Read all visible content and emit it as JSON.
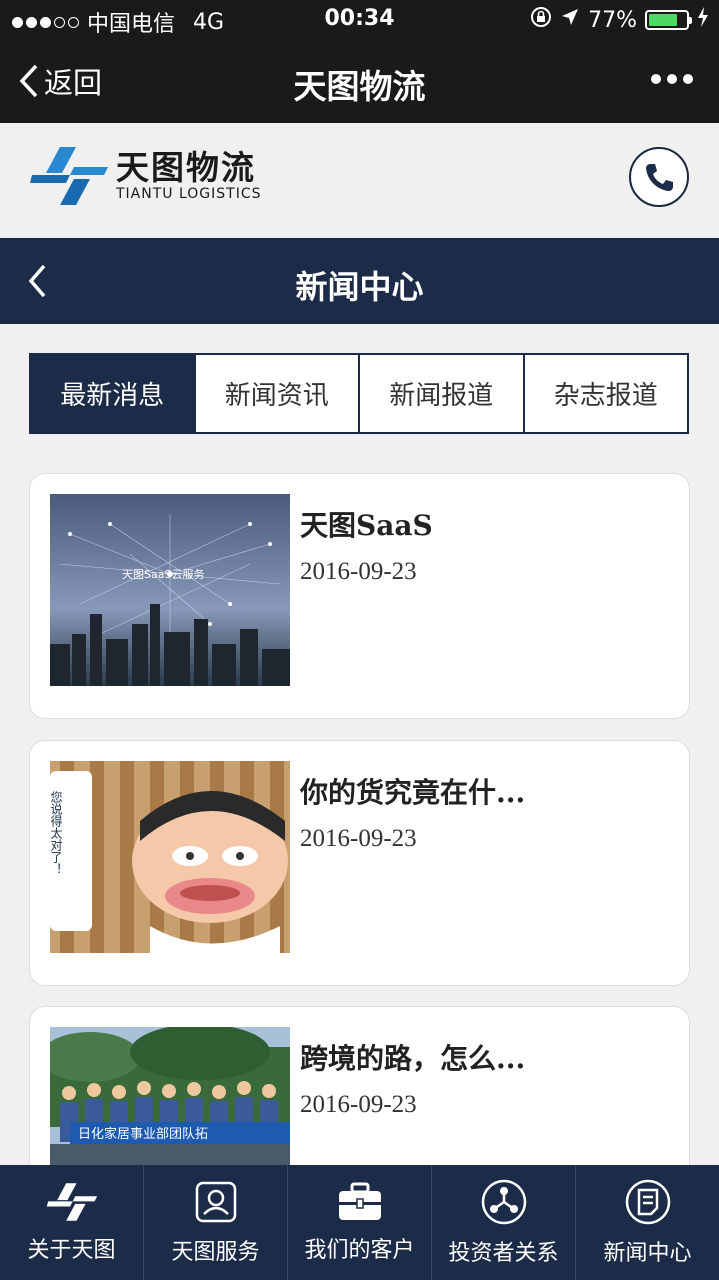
{
  "status_bar": {
    "carrier": "中国电信",
    "network": "4G",
    "time": "00:34",
    "battery": "77%",
    "battery_level": 0.77,
    "battery_color": "#4cd964"
  },
  "wechat_bar": {
    "back_label": "返回",
    "title": "天图物流"
  },
  "brand": {
    "name_cn": "天图物流",
    "name_en": "TIANTU LOGISTICS",
    "phone_icon": "phone-icon"
  },
  "section": {
    "title": "新闻中心"
  },
  "tabs": [
    {
      "label": "最新消息",
      "active": true
    },
    {
      "label": "新闻资讯",
      "active": false
    },
    {
      "label": "新闻报道",
      "active": false
    },
    {
      "label": "杂志报道",
      "active": false
    }
  ],
  "news": [
    {
      "title": "天图SaaS",
      "date": "2016-09-23",
      "thumb_text": "天图SaaS云服务"
    },
    {
      "title": "你的货究竟在什...",
      "date": "2016-09-23",
      "thumb_text": "您说得太对了！"
    },
    {
      "title": "跨境的路，怎么...",
      "date": "2016-09-23",
      "thumb_text": "日化家居事业部团队拓"
    }
  ],
  "bottom_nav": [
    {
      "label": "关于天图",
      "icon": "logo-icon"
    },
    {
      "label": "天图服务",
      "icon": "service-icon"
    },
    {
      "label": "我们的客户",
      "icon": "briefcase-icon"
    },
    {
      "label": "投资者关系",
      "icon": "network-icon"
    },
    {
      "label": "新闻中心",
      "icon": "news-icon"
    }
  ],
  "colors": {
    "primary": "#1c2c48",
    "status_bg": "#1a1a1a",
    "page_bg": "#f0f0f0"
  }
}
